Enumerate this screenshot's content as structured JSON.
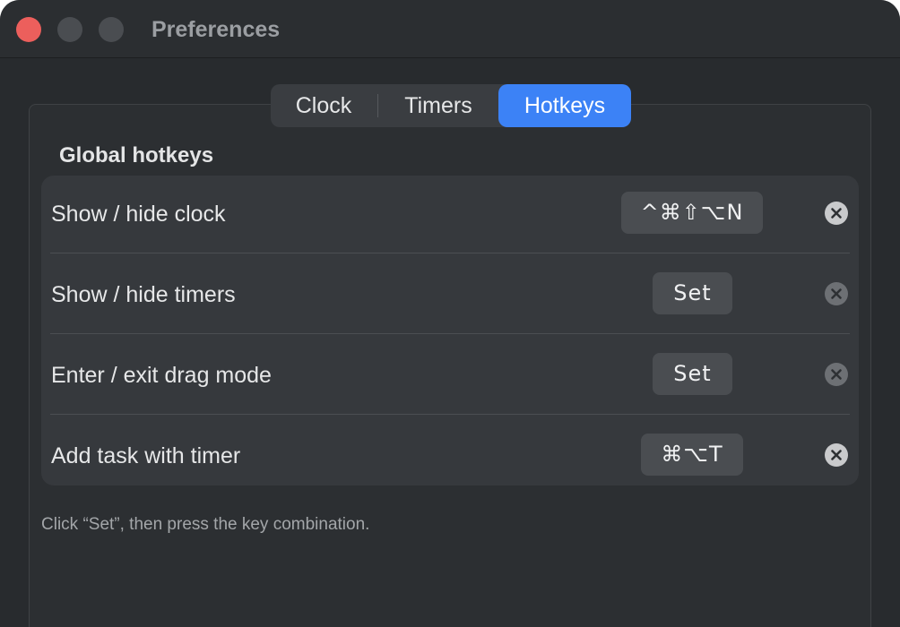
{
  "window": {
    "title": "Preferences"
  },
  "tabs": [
    {
      "label": "Clock",
      "selected": false
    },
    {
      "label": "Timers",
      "selected": false
    },
    {
      "label": "Hotkeys",
      "selected": true
    }
  ],
  "section": {
    "heading": "Global hotkeys"
  },
  "hotkeys": [
    {
      "label": "Show / hide clock",
      "shortcut": "^⌘⇧⌥N",
      "clear_icon": "x-circle-icon"
    },
    {
      "label": "Show / hide timers",
      "shortcut": "Set",
      "clear_icon": "x-circle-icon"
    },
    {
      "label": "Enter / exit drag mode",
      "shortcut": "Set",
      "clear_icon": "x-circle-icon"
    },
    {
      "label": "Add task with timer",
      "shortcut": "⌘⌥T",
      "clear_icon": "x-circle-icon"
    }
  ],
  "hint": "Click “Set”, then press the key combination.",
  "colors": {
    "accent": "#3c82f6",
    "close_light": "#ec5f5c",
    "background": "#282b2e"
  }
}
